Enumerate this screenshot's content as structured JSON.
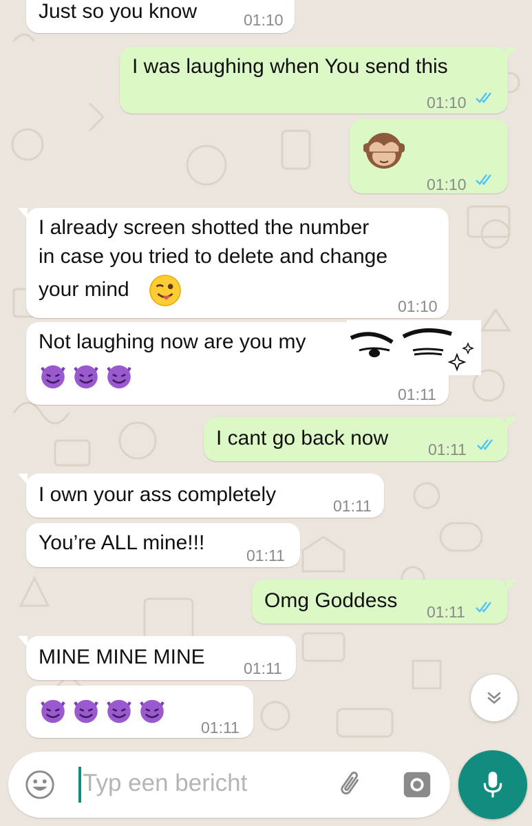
{
  "colors": {
    "wallpaper": "#ece5dd",
    "incoming_bubble": "#ffffff",
    "outgoing_bubble": "#dcf8c6",
    "read_ticks": "#4fc3f7",
    "accent": "#128c7e"
  },
  "messages": [
    {
      "direction": "incoming",
      "text": "Just so you know",
      "time": "01:10"
    },
    {
      "direction": "outgoing",
      "text": "I was laughing when You send this",
      "time": "01:10",
      "status": "read"
    },
    {
      "direction": "outgoing",
      "emoji": "see-no-evil-monkey",
      "time": "01:10",
      "status": "read"
    },
    {
      "direction": "incoming",
      "lines": [
        "I already screen shotted the number",
        "in case you tried to delete and change",
        "your mind"
      ],
      "emoji": "winking-face-with-tongue",
      "time": "01:10"
    },
    {
      "direction": "incoming",
      "text": "Not laughing now are you my",
      "emojis": [
        "smiling-devil",
        "smiling-devil",
        "smiling-devil"
      ],
      "sticker": "anime-eyes",
      "time": "01:11"
    },
    {
      "direction": "outgoing",
      "text": "I cant go back now",
      "time": "01:11",
      "status": "read"
    },
    {
      "direction": "incoming",
      "text": "I own your ass completely",
      "time": "01:11"
    },
    {
      "direction": "incoming",
      "text": "You’re ALL mine!!!",
      "time": "01:11"
    },
    {
      "direction": "outgoing",
      "text": "Omg Goddess",
      "time": "01:11",
      "status": "read"
    },
    {
      "direction": "incoming",
      "text": "MINE MINE MINE",
      "time": "01:11"
    },
    {
      "direction": "incoming",
      "emojis": [
        "smiling-devil",
        "smiling-devil",
        "smiling-devil",
        "smiling-devil"
      ],
      "time": "01:11"
    }
  ],
  "composer": {
    "placeholder": "Typ een bericht",
    "emoji_icon": "smiley-icon",
    "attach_icon": "paperclip-icon",
    "camera_icon": "camera-icon",
    "send_icon": "microphone-icon"
  },
  "scroll_down_icon": "double-chevron-down-icon"
}
